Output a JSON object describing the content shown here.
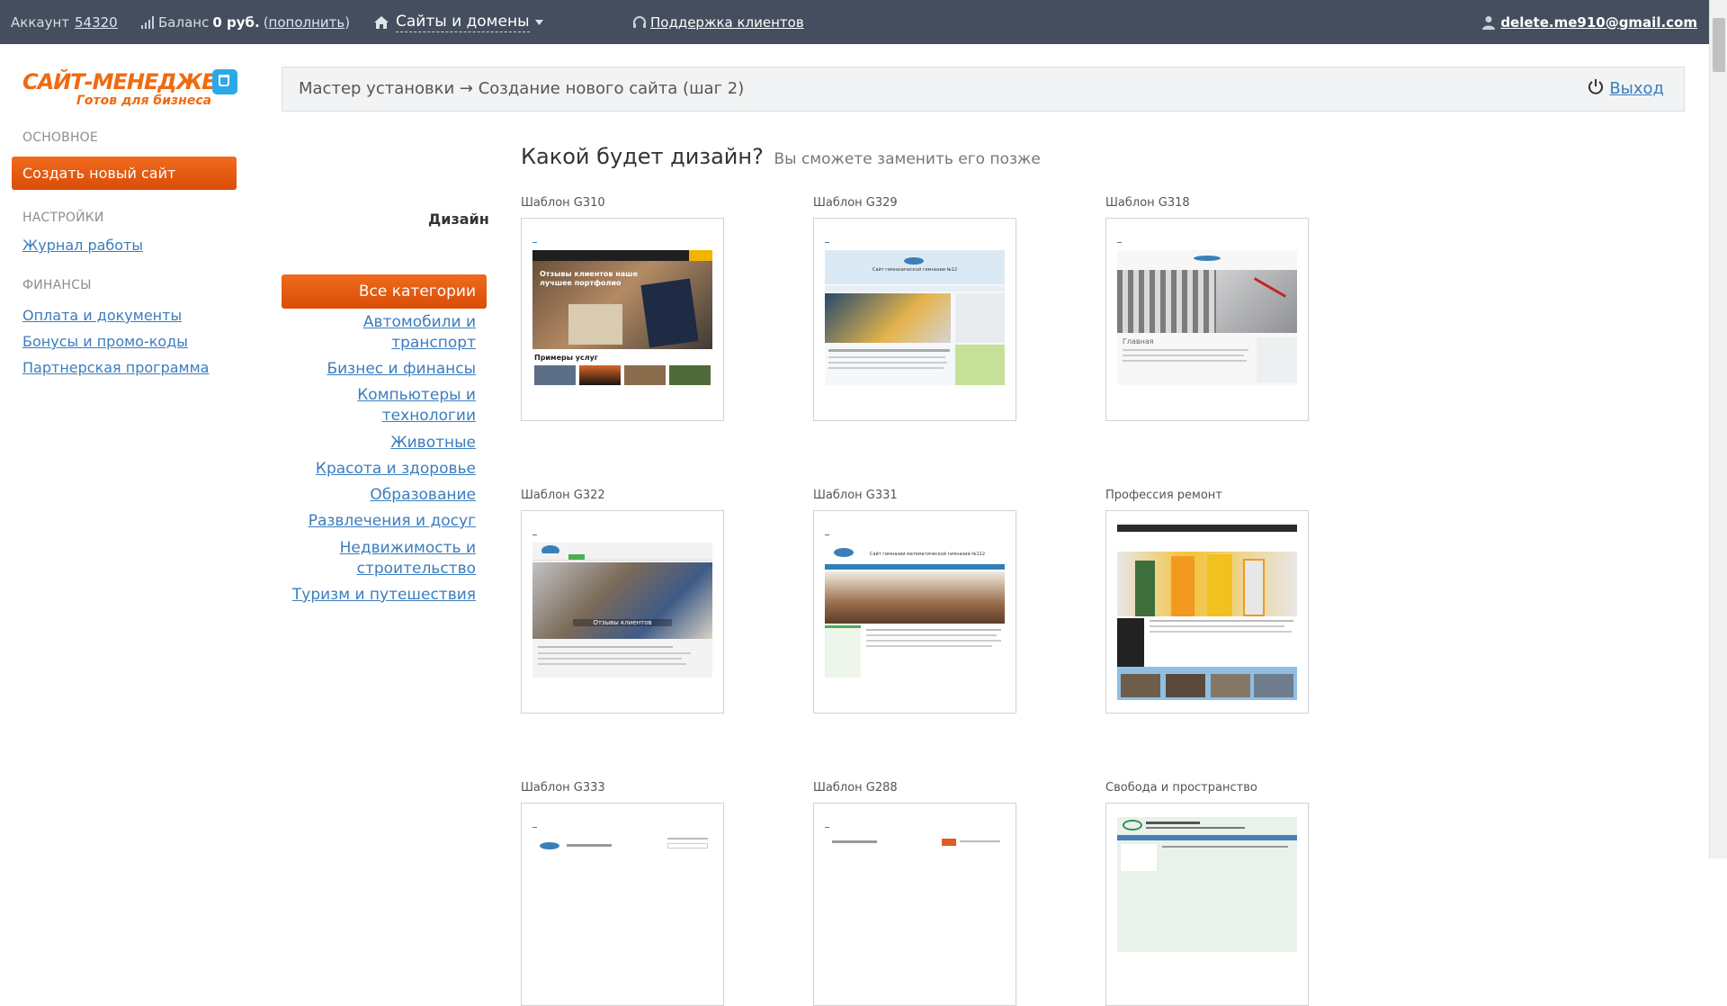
{
  "topbar": {
    "account_label": "Аккаунт",
    "account_id": "54320",
    "balance_label": "Баланс",
    "balance_value": "0 руб.",
    "topup_open": "(",
    "topup_link": "пополнить",
    "topup_close": ")",
    "sites_label": "Сайты и домены",
    "support_label": "Поддержка клиентов",
    "user_email": "delete.me910@gmail.com"
  },
  "sidebar": {
    "logo_main": "САЙТ-МЕНЕДЖЕР",
    "logo_sub": "Готов для бизнеса",
    "section_main": "ОСНОВНОЕ",
    "create_button": "Создать новый сайт",
    "section_settings": "НАСТРОЙКИ",
    "journal_link": "Журнал работы",
    "section_finance": "ФИНАНСЫ",
    "finance_links": [
      "Оплата и документы",
      "Бонусы и промо-коды",
      "Партнерская программа"
    ]
  },
  "header": {
    "breadcrumb": "Мастер установки → Создание нового сайта (шаг 2)",
    "logout": "Выход"
  },
  "filters": {
    "label": "Дизайн",
    "all": "Все категории",
    "categories": [
      "Автомобили и\nтранспорт",
      "Бизнес и финансы",
      "Компьютеры и\nтехнологии",
      "Животные",
      "Красота и здоровье",
      "Образование",
      "Развлечения и досуг",
      "Недвижимость и\nстроительство",
      "Туризм и путешествия"
    ]
  },
  "main": {
    "title": "Какой будет дизайн?",
    "subtitle": "Вы сможете заменить его позже",
    "templates": [
      {
        "name": "Шаблон G310",
        "thumb_title": "Отзывы клиентов наше лучшее портфолио",
        "thumb_caption": "Примеры услуг"
      },
      {
        "name": "Шаблон G329",
        "thumb_title": "Сайт гимназической гимназии №12"
      },
      {
        "name": "Шаблон G318",
        "thumb_caption": "Главная"
      },
      {
        "name": "Шаблон G322",
        "thumb_title": "Отзывы клиентов"
      },
      {
        "name": "Шаблон G331",
        "thumb_title": "Сайт гимназии математической гимназии №112"
      },
      {
        "name": "Профессия ремонт"
      },
      {
        "name": "Шаблон G333"
      },
      {
        "name": "Шаблон G288"
      },
      {
        "name": "Свобода и пространство"
      }
    ]
  },
  "colors": {
    "topbar": "#454e5e",
    "accent_orange": "#e85c10",
    "link_blue": "#3b7dbf"
  }
}
